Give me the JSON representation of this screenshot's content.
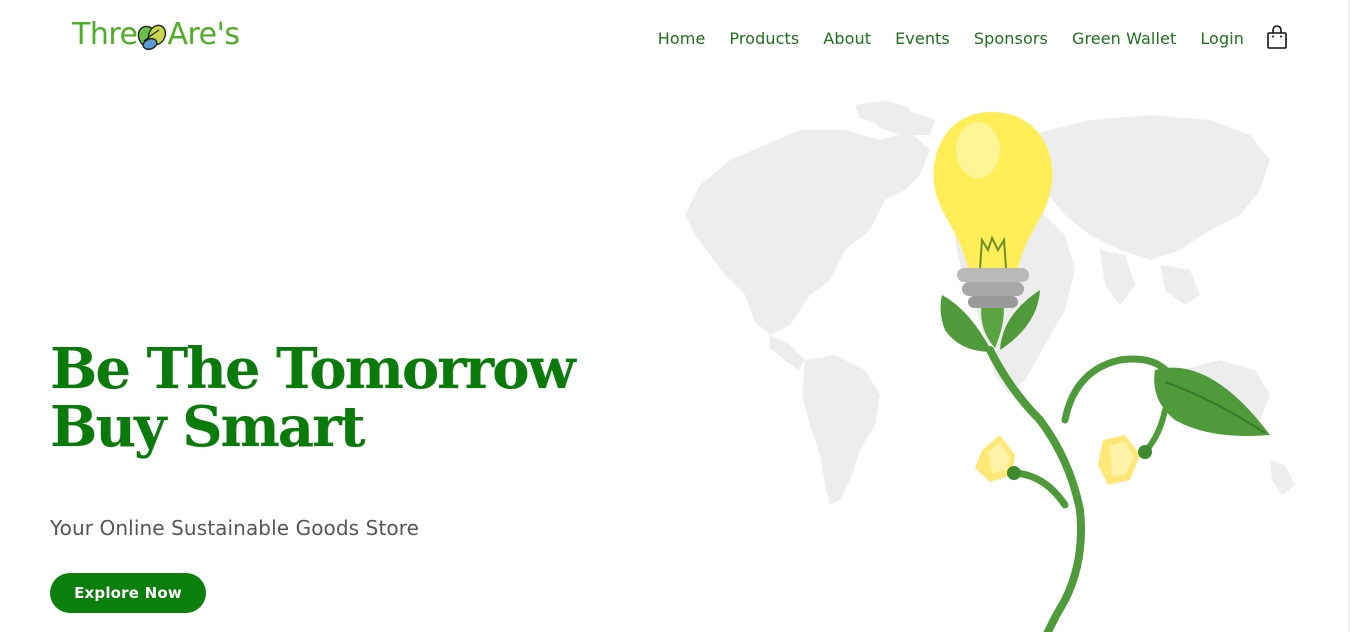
{
  "header": {
    "logo_text": "ThreeAre's",
    "logo_text_left": "Thre",
    "logo_text_right": "Are's",
    "nav_items": [
      {
        "label": "Home"
      },
      {
        "label": "Products"
      },
      {
        "label": "About"
      },
      {
        "label": "Events"
      },
      {
        "label": "Sponsors"
      },
      {
        "label": "Green Wallet"
      },
      {
        "label": "Login"
      }
    ],
    "cart_icon": "shopping-bag-icon"
  },
  "hero": {
    "title_line1": "Be The Tomorrow",
    "title_line2": "Buy Smart",
    "subtitle": "Your Online Sustainable Goods Store",
    "cta_label": "Explore Now"
  },
  "illustration": {
    "description_icon": "world-map-lightbulb-plant-icon"
  },
  "colors": {
    "brand_green": "#0b7f0b",
    "logo_green": "#4fae25",
    "nav_green": "#1f6f1f",
    "bulb_yellow": "#ffee58",
    "leaf_green": "#4f9a3a",
    "map_gray": "#eeeeef"
  }
}
